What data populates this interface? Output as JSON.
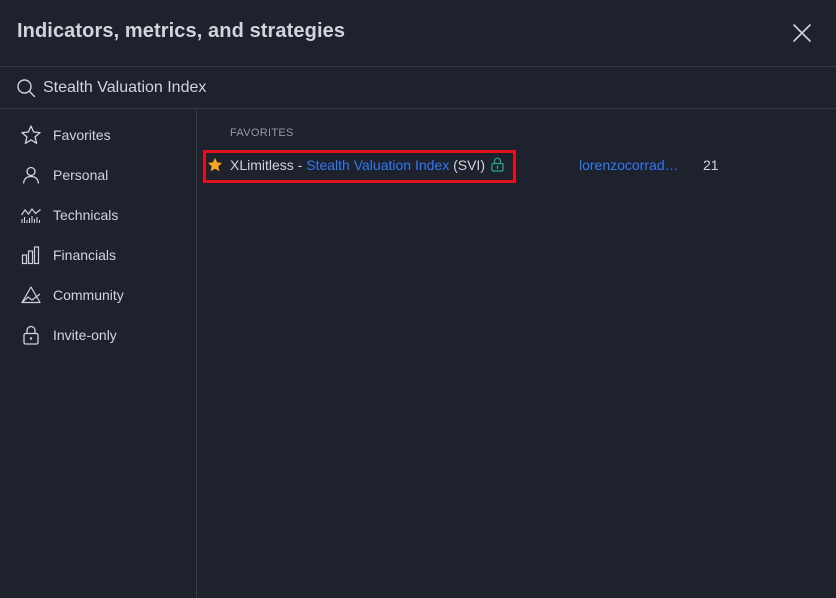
{
  "dialog": {
    "title": "Indicators, metrics, and strategies"
  },
  "search": {
    "value": "Stealth Valuation Index"
  },
  "sidebar": {
    "items": [
      {
        "label": "Favorites",
        "icon": "star-outline-icon"
      },
      {
        "label": "Personal",
        "icon": "person-icon"
      },
      {
        "label": "Technicals",
        "icon": "technicals-chart-icon"
      },
      {
        "label": "Financials",
        "icon": "bar-chart-icon"
      },
      {
        "label": "Community",
        "icon": "community-icon"
      },
      {
        "label": "Invite-only",
        "icon": "lock-icon"
      }
    ]
  },
  "results": {
    "section_title": "FAVORITES",
    "rows": [
      {
        "author_prefix": "XLimitless",
        "separator": " - ",
        "name": "Stealth Valuation Index",
        "abbr": " (SVI)",
        "author": "lorenzocorrad…",
        "count": "21",
        "favorited": true,
        "invite_only": true
      }
    ]
  },
  "colors": {
    "background": "#1e222d",
    "border": "#363a45",
    "text": "#d1d4dc",
    "muted": "#9598a1",
    "link": "#3179f5",
    "star": "#f5a623",
    "lock": "#22ab94",
    "highlight": "#e0121b"
  }
}
